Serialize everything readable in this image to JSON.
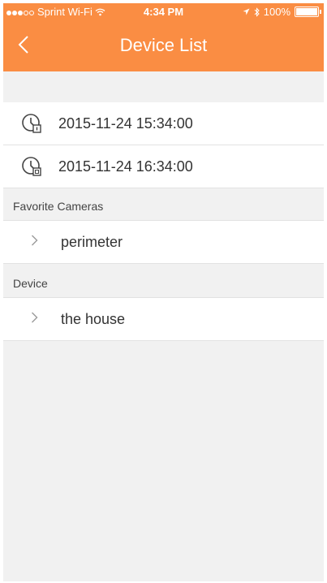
{
  "status_bar": {
    "carrier": "Sprint Wi-Fi",
    "time": "4:34 PM",
    "battery": "100%"
  },
  "nav": {
    "title": "Device List",
    "back_icon": "chevron-left-icon"
  },
  "recent_times": [
    {
      "label": "2015-11-24 15:34:00",
      "icon": "clock-icon"
    },
    {
      "label": "2015-11-24 16:34:00",
      "icon": "clock-icon"
    }
  ],
  "sections": {
    "favorites": {
      "header": "Favorite Cameras",
      "items": [
        "perimeter"
      ]
    },
    "device": {
      "header": "Device",
      "items": [
        "the house"
      ]
    }
  },
  "colors": {
    "accent": "#fa8d43",
    "background": "#f1f1f1"
  }
}
